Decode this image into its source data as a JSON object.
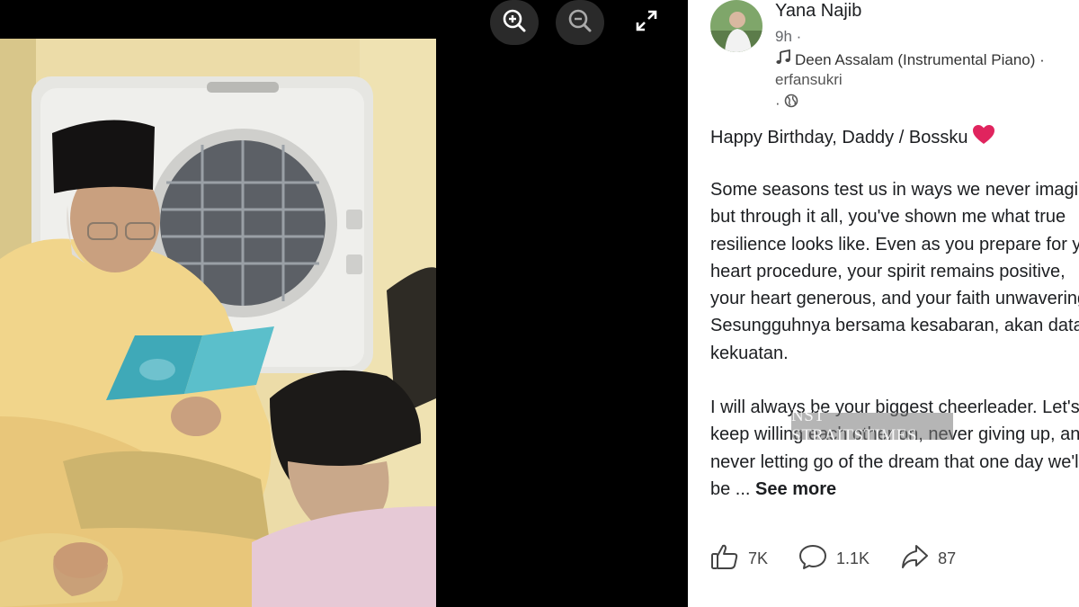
{
  "viewer": {
    "controls": [
      {
        "name": "zoom-in-icon"
      },
      {
        "name": "zoom-out-icon"
      },
      {
        "name": "fullscreen-icon"
      }
    ]
  },
  "post": {
    "author": "Yana Najib",
    "time": "9h ·",
    "music_title": "Deen Assalam (Instrumental Piano) ·",
    "music_artist": "erfansukri",
    "privacy_prefix": "·",
    "greeting": "Happy Birthday, Daddy / Bossku",
    "paragraph1": [
      "Some seasons test us in ways we never imagined,",
      "but through it all, you've shown me what true",
      "resilience looks like. Even as you prepare for your",
      "heart procedure, your spirit remains positive,",
      "your heart generous, and your faith unwavering.",
      "Sesungguhnya bersama kesabaran, akan datang",
      "kekuatan."
    ],
    "paragraph2": [
      "I will always be your biggest cheerleader. Let's",
      "keep willing each other on, never giving up, and",
      "never letting go of the dream that one day we'll"
    ],
    "truncated_prefix": "be ...",
    "see_more": "See more",
    "watermark": "NST STRAITSTIMES",
    "reactions": {
      "likes": "7K",
      "comments": "1.1K",
      "shares": "87"
    },
    "colors": {
      "heart": "#e0245e",
      "text": "#1c1e21"
    }
  }
}
